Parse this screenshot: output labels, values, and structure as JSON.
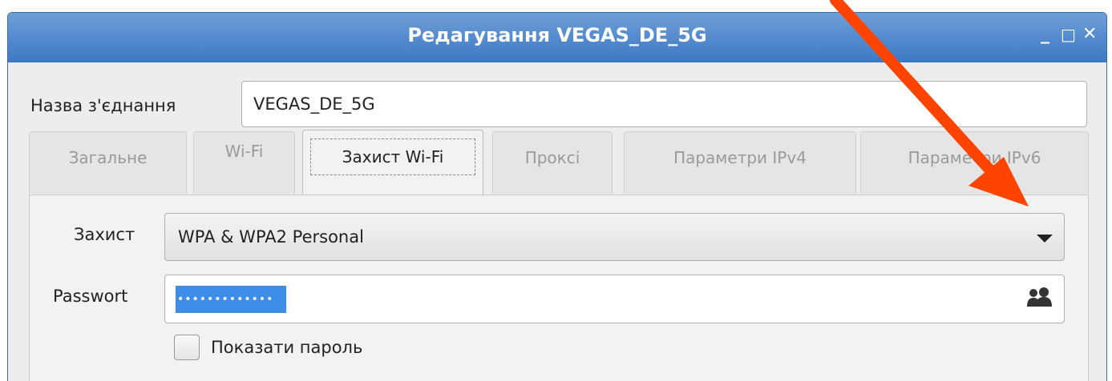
{
  "window": {
    "title": "Редагування VEGAS_DE_5G",
    "controls": {
      "minimize": "_",
      "maximize": "□",
      "close": "✕"
    }
  },
  "connection": {
    "label": "Назва з'єднання",
    "value": "VEGAS_DE_5G"
  },
  "tabs": [
    {
      "label": "Загальне",
      "active": false
    },
    {
      "label": "Wi-Fi",
      "active": false
    },
    {
      "label": "Захист Wi-Fi",
      "active": true
    },
    {
      "label": "Проксі",
      "active": false
    },
    {
      "label": "Параметри IPv4",
      "active": false
    },
    {
      "label": "Параметри IPv6",
      "active": false
    }
  ],
  "security": {
    "label": "Захист",
    "selected": "WPA & WPA2 Personal"
  },
  "password": {
    "label": "Passwort",
    "masked_value": "•••••••••••••"
  },
  "show_password": {
    "label": "Показати пароль",
    "checked": false
  },
  "colors": {
    "titlebar": "#4a84cb",
    "selection": "#3d8ee9",
    "annotation_arrow": "#ff4400"
  }
}
